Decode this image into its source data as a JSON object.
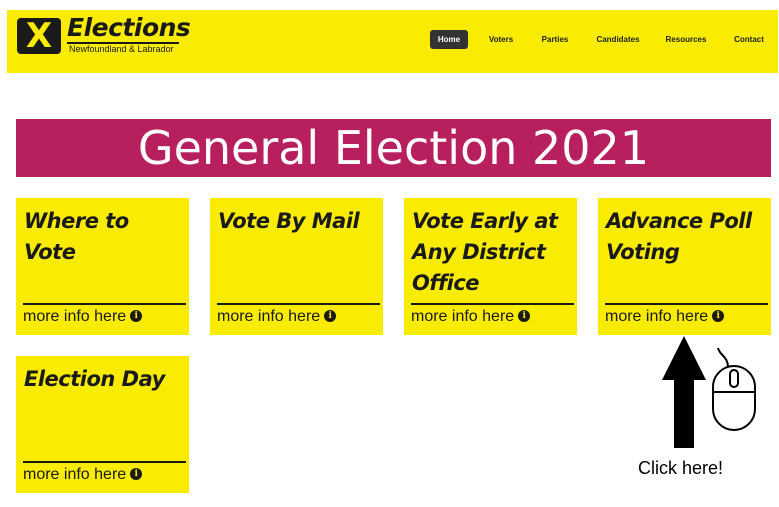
{
  "header": {
    "logo_mark": "X",
    "logo_title": "Elections",
    "logo_subtitle": "Newfoundland & Labrador",
    "nav": [
      {
        "label": "Home",
        "active": true
      },
      {
        "label": "Voters",
        "active": false
      },
      {
        "label": "Parties",
        "active": false
      },
      {
        "label": "Candidates",
        "active": false
      },
      {
        "label": "Resources",
        "active": false
      },
      {
        "label": "Contact",
        "active": false
      }
    ]
  },
  "banner": {
    "title": "General Election 2021"
  },
  "cards": [
    {
      "title": "Where to Vote",
      "more": "more info here"
    },
    {
      "title": "Vote By Mail",
      "more": "more info here"
    },
    {
      "title": "Vote Early at Any District Office",
      "more": "more info here"
    },
    {
      "title": "Advance Poll Voting",
      "more": "more info here"
    },
    {
      "title": "Election Day",
      "more": "more info here"
    }
  ],
  "annotation": {
    "label": "Click here!"
  },
  "colors": {
    "header_bg": "#f9ec00",
    "banner_bg": "#b81f5e",
    "card_bg": "#f9ec00",
    "text_dark": "#1a1a1a"
  },
  "icons": [
    "logo-x-icon",
    "info-icon",
    "arrow-up-icon",
    "mouse-icon"
  ]
}
